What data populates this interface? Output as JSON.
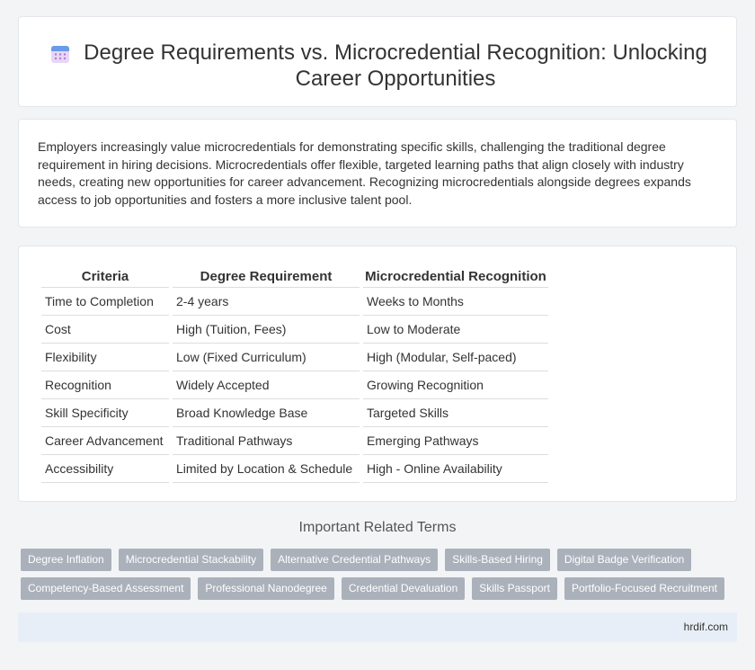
{
  "header": {
    "title": "Degree Requirements vs. Microcredential Recognition: Unlocking Career Opportunities",
    "icon": "calendar-icon"
  },
  "intro": {
    "text": "Employers increasingly value microcredentials for demonstrating specific skills, challenging the traditional degree requirement in hiring decisions. Microcredentials offer flexible, targeted learning paths that align closely with industry needs, creating new opportunities for career advancement. Recognizing microcredentials alongside degrees expands access to job opportunities and fosters a more inclusive talent pool."
  },
  "table": {
    "headers": [
      "Criteria",
      "Degree Requirement",
      "Microcredential Recognition"
    ],
    "rows": [
      [
        "Time to Completion",
        "2-4 years",
        "Weeks to Months"
      ],
      [
        "Cost",
        "High (Tuition, Fees)",
        "Low to Moderate"
      ],
      [
        "Flexibility",
        "Low (Fixed Curriculum)",
        "High (Modular, Self-paced)"
      ],
      [
        "Recognition",
        "Widely Accepted",
        "Growing Recognition"
      ],
      [
        "Skill Specificity",
        "Broad Knowledge Base",
        "Targeted Skills"
      ],
      [
        "Career Advancement",
        "Traditional Pathways",
        "Emerging Pathways"
      ],
      [
        "Accessibility",
        "Limited by Location & Schedule",
        "High - Online Availability"
      ]
    ]
  },
  "related": {
    "title": "Important Related Terms",
    "tags_row1": [
      "Degree Inflation",
      "Microcredential Stackability",
      "Alternative Credential Pathways",
      "Skills-Based Hiring",
      "Digital Badge Verification"
    ],
    "tags_row2": [
      "Competency-Based Assessment",
      "Professional Nanodegree",
      "Credential Devaluation",
      "Skills Passport",
      "Portfolio-Focused Recruitment"
    ]
  },
  "footer": {
    "site": "hrdif.com"
  },
  "colors": {
    "page_bg": "#f3f4f6",
    "tag_bg": "#aab1bb",
    "footer_bg": "#e8eef7"
  }
}
